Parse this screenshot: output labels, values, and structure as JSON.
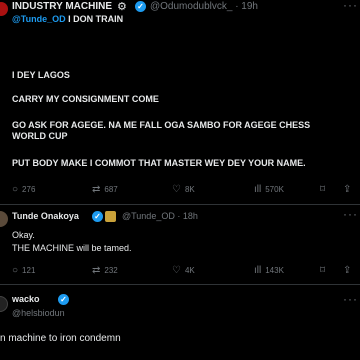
{
  "tweet1": {
    "author_name": "INDUSTRY MACHINE",
    "author_emoji": "⚙",
    "handle_time": "@Odumodublvck_ · 19h",
    "reply_mention": "@Tunde_OD",
    "reply_text": " I DON TRAIN",
    "paragraphs": [
      "I DEY LAGOS",
      "CARRY MY CONSIGNMENT COME",
      "GO ASK FOR AGEGE. NA ME FALL OGA SAMBO FOR AGEGE CHESS WORLD CUP",
      "PUT BODY MAKE I COMMOT THAT MASTER WEY DEY YOUR NAME."
    ],
    "replies": "276",
    "reposts": "687",
    "likes": "8K",
    "views": "570K"
  },
  "tweet2": {
    "author_name": "Tunde Onakoya",
    "handle_time": "@Tunde_OD · 18h",
    "lines": [
      "Okay.",
      "THE MACHINE will be tamed."
    ],
    "replies": "121",
    "reposts": "232",
    "likes": "4K",
    "views": "143K"
  },
  "tweet3": {
    "author_name": "wacko",
    "handle": "@helsbiodun",
    "text": "n machine to iron condemn"
  },
  "icons": {
    "reply": "reply-icon",
    "repost": "repost-icon",
    "like": "heart-icon",
    "views": "views-icon",
    "bookmark": "bookmark-icon",
    "share": "share-icon",
    "more": "more-icon",
    "verified": "verified-badge-icon"
  },
  "colors": {
    "background": "#000000",
    "text": "#e7e9ea",
    "muted": "#71767b",
    "accent": "#1d9bf0",
    "divider": "#2f3336"
  }
}
